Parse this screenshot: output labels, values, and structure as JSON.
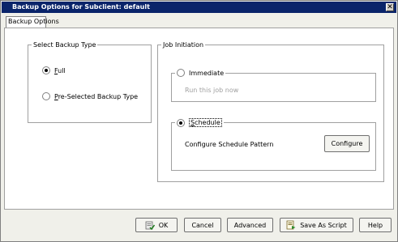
{
  "window": {
    "title": "Backup Options for Subclient: default",
    "close_label": "✕"
  },
  "tabs": [
    {
      "label": "Backup Options"
    }
  ],
  "backup_type": {
    "legend": "Select Backup Type",
    "options": [
      {
        "label_key": "F",
        "label_rest": "ull",
        "selected": true
      },
      {
        "label_key": "P",
        "label_rest": "re-Selected Backup Type",
        "selected": false
      }
    ]
  },
  "job_initiation": {
    "legend": "Job Initiation",
    "immediate": {
      "label": "Immediate",
      "selected": false,
      "description": "Run this job now"
    },
    "schedule": {
      "label_key": "S",
      "label_rest": "chedule",
      "selected": true,
      "pattern_label": "Configure Schedule Pattern",
      "configure_button": "Configure"
    }
  },
  "footer_buttons": {
    "ok": "OK",
    "cancel": "Cancel",
    "advanced": "Advanced",
    "save_script": "Save As Script",
    "help": "Help"
  },
  "colors": {
    "titlebar": "#0a246a",
    "dialog_bg": "#f0f0ea",
    "panel_bg": "#ffffff"
  }
}
